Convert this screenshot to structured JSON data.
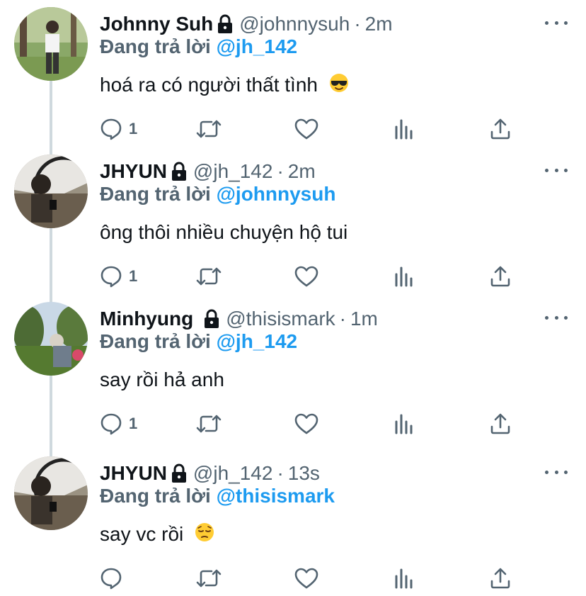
{
  "tweets": [
    {
      "name": "Johnny Suh",
      "handle": "@johnnysuh",
      "separator": "·",
      "time": "2m",
      "replying_prefix": "Đang trả lời",
      "replying_to": "@jh_142",
      "text": "hoá ra có người thất tình",
      "emoji": "smiling-face-with-sunglasses",
      "reply_count": "1"
    },
    {
      "name": "JHYUN",
      "handle": "@jh_142",
      "separator": "·",
      "time": "2m",
      "replying_prefix": "Đang trả lời",
      "replying_to": "@johnnysuh",
      "text": "ông thôi nhiều chuyện hộ tui",
      "emoji": "",
      "reply_count": "1"
    },
    {
      "name": "Minhyung",
      "handle": "@thisismark",
      "separator": "·",
      "time": "1m",
      "replying_prefix": "Đang trả lời",
      "replying_to": "@jh_142",
      "text": "say rồi hả anh",
      "emoji": "",
      "reply_count": "1"
    },
    {
      "name": "JHYUN",
      "handle": "@jh_142",
      "separator": "·",
      "time": "13s",
      "replying_prefix": "Đang trả lời",
      "replying_to": "@thisismark",
      "text": "say vc rồi",
      "emoji": "pensive-face",
      "reply_count": ""
    }
  ],
  "icons": {
    "reply": "reply-icon",
    "retweet": "retweet-icon",
    "like": "like-icon",
    "analytics": "analytics-icon",
    "share": "share-icon",
    "lock": "lock-icon",
    "more": "more-icon"
  },
  "colors": {
    "text": "#0f1419",
    "secondary": "#536471",
    "link": "#1d9bf0",
    "thread_line": "#cfd9de"
  }
}
